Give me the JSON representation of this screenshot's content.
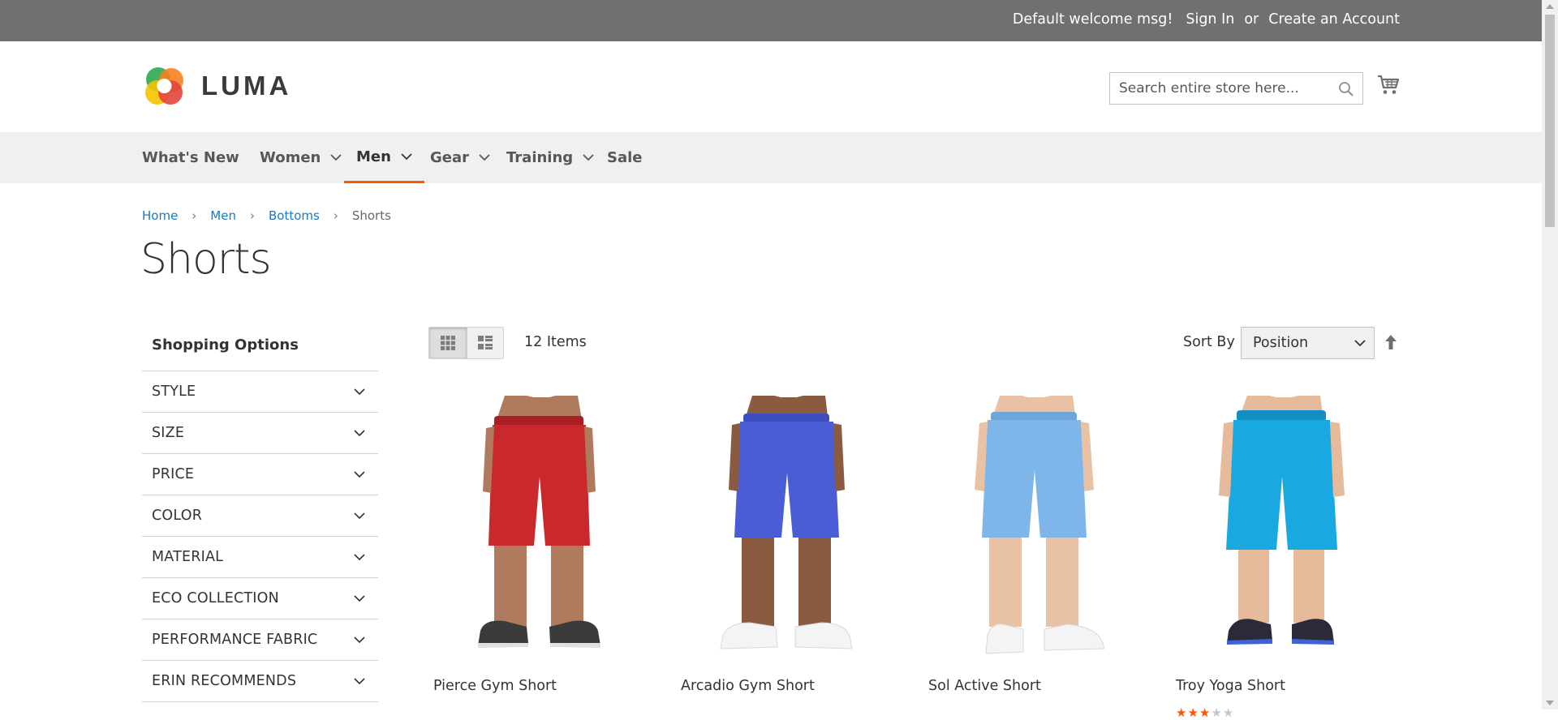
{
  "topbar": {
    "welcome": "Default welcome msg!",
    "sign_in": "Sign In",
    "or": "or",
    "create_account": "Create an Account"
  },
  "header": {
    "logo_text": "LUMA",
    "search_placeholder": "Search entire store here...",
    "search_value": ""
  },
  "nav": {
    "items": [
      {
        "label": "What's New"
      },
      {
        "label": "Women"
      },
      {
        "label": "Men"
      },
      {
        "label": "Gear"
      },
      {
        "label": "Training"
      },
      {
        "label": "Sale"
      }
    ],
    "active": "Men"
  },
  "breadcrumb": [
    "Home",
    "Men",
    "Bottoms",
    "Shorts"
  ],
  "page_title": "Shorts",
  "sidebar": {
    "title": "Shopping Options",
    "filters": [
      "STYLE",
      "SIZE",
      "PRICE",
      "COLOR",
      "MATERIAL",
      "ECO COLLECTION",
      "PERFORMANCE FABRIC",
      "ERIN RECOMMENDS"
    ]
  },
  "toolbar": {
    "item_count": "12 Items",
    "sort_label": "Sort By",
    "sort_value": "Position",
    "view_mode": "grid"
  },
  "products": [
    {
      "name": "Pierce Gym Short",
      "color": "#c9282d"
    },
    {
      "name": "Arcadio Gym Short",
      "color": "#4a5dd4"
    },
    {
      "name": "Sol Active Short",
      "color": "#7fb6ea"
    },
    {
      "name": "Troy Yoga Short",
      "color": "#1aa8e0",
      "rating_stars": 3,
      "rating_max": 5
    }
  ],
  "colors": {
    "topbar_bg": "#6e716e",
    "nav_bg": "#f0f0f0",
    "accent": "#ff5501",
    "link": "#1979c3"
  }
}
